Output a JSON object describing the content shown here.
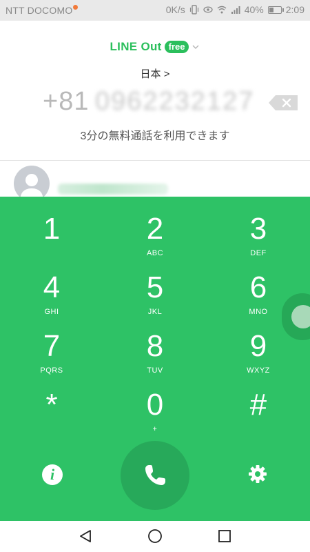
{
  "status_bar": {
    "carrier": "NTT DOCOMO",
    "speed": "0K/s",
    "battery": "40%",
    "battery_level": 0.4,
    "time": "2:09"
  },
  "header": {
    "brand": "LINE Out",
    "badge": "free",
    "country": "日本 >",
    "country_code": "+81",
    "phone_number": "0962232127",
    "free_call_text": "3分の無料通話を利用できます"
  },
  "keypad": {
    "keys": [
      {
        "digit": "1",
        "letters": ""
      },
      {
        "digit": "2",
        "letters": "ABC"
      },
      {
        "digit": "3",
        "letters": "DEF"
      },
      {
        "digit": "4",
        "letters": "GHI"
      },
      {
        "digit": "5",
        "letters": "JKL"
      },
      {
        "digit": "6",
        "letters": "MNO"
      },
      {
        "digit": "7",
        "letters": "PQRS"
      },
      {
        "digit": "8",
        "letters": "TUV"
      },
      {
        "digit": "9",
        "letters": "WXYZ"
      },
      {
        "digit": "*",
        "letters": ""
      },
      {
        "digit": "0",
        "letters": "+"
      },
      {
        "digit": "#",
        "letters": ""
      }
    ],
    "info_label": "i"
  },
  "colors": {
    "brand_green": "#2bbf5c",
    "keypad_green": "#2ec266",
    "call_button": "#27a95a"
  }
}
